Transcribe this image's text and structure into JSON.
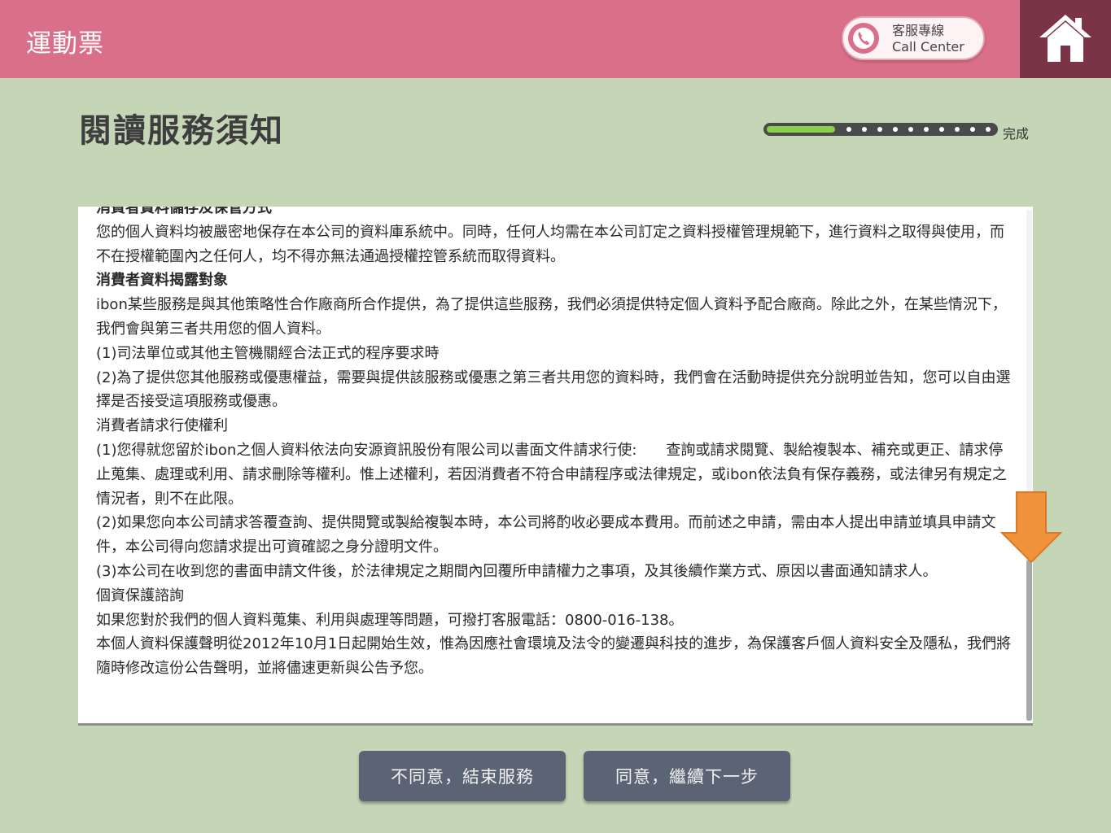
{
  "header": {
    "app_title": "運動票",
    "call_center_zh": "客服專線",
    "call_center_en": "Call Center",
    "phone_icon": "phone-icon",
    "home_icon": "home-icon",
    "accent_color": "#d96f88",
    "home_bg_color": "#7a3446"
  },
  "page": {
    "title": "閱讀服務須知",
    "progress_end_label": "完成",
    "progress_fraction": 0.3
  },
  "notice": {
    "lines": [
      {
        "text": "消費者資料儲存及保管方式",
        "bold": true
      },
      {
        "text": "您的個人資料均被嚴密地保存在本公司的資料庫系統中。同時，任何人均需在本公司訂定之資料授權管理規範下，進行資料之取得與使用，而不在授權範圍內之任何人，均不得亦無法通過授權控管系統而取得資料。",
        "bold": false
      },
      {
        "text": "消費者資料揭露對象",
        "bold": true
      },
      {
        "text": "ibon某些服務是與其他策略性合作廠商所合作提供，為了提供這些服務，我們必須提供特定個人資料予配合廠商。除此之外，在某些情況下，我們會與第三者共用您的個人資料。",
        "bold": false
      },
      {
        "text": "(1)司法單位或其他主管機關經合法正式的程序要求時",
        "bold": false
      },
      {
        "text": "(2)為了提供您其他服務或優惠權益，需要與提供該服務或優惠之第三者共用您的資料時，我們會在活動時提供充分說明並告知，您可以自由選擇是否接受這項服務或優惠。",
        "bold": false
      },
      {
        "text": "消費者請求行使權利",
        "bold": false
      },
      {
        "text": "(1)您得就您留於ibon之個人資料依法向安源資訊股份有限公司以書面文件請求行使:　　查詢或請求閱覽、製給複製本、補充或更正、請求停止蒐集、處理或利用、請求刪除等權利。惟上述權利，若因消費者不符合申請程序或法律規定，或ibon依法負有保存義務，或法律另有規定之情況者，則不在此限。",
        "bold": false
      },
      {
        "text": "(2)如果您向本公司請求答覆查詢、提供閱覽或製給複製本時，本公司將酌收必要成本費用。而前述之申請，需由本人提出申請並填具申請文件，本公司得向您請求提出可資確認之身分證明文件。",
        "bold": false
      },
      {
        "text": "(3)本公司在收到您的書面申請文件後，於法律規定之期間內回覆所申請權力之事項，及其後續作業方式、原因以書面通知請求人。",
        "bold": false
      },
      {
        "text": "個資保護諮詢",
        "bold": false
      },
      {
        "text": "如果您對於我們的個人資料蒐集、利用與處理等問題，可撥打客服電話：0800-016-138。",
        "bold": false
      },
      {
        "text": "本個人資料保護聲明從2012年10月1日起開始生效，惟為因應社會環境及法令的變遷與科技的進步，為保護客戶個人資料安全及隱私，我們將隨時修改這份公告聲明，並將儘速更新與公告予您。",
        "bold": false
      }
    ],
    "scroll_arrow_icon": "down-arrow-icon",
    "scroll_arrow_color": "#f0923a"
  },
  "buttons": {
    "disagree": "不同意，結束服務",
    "agree": "同意，繼續下一步"
  }
}
